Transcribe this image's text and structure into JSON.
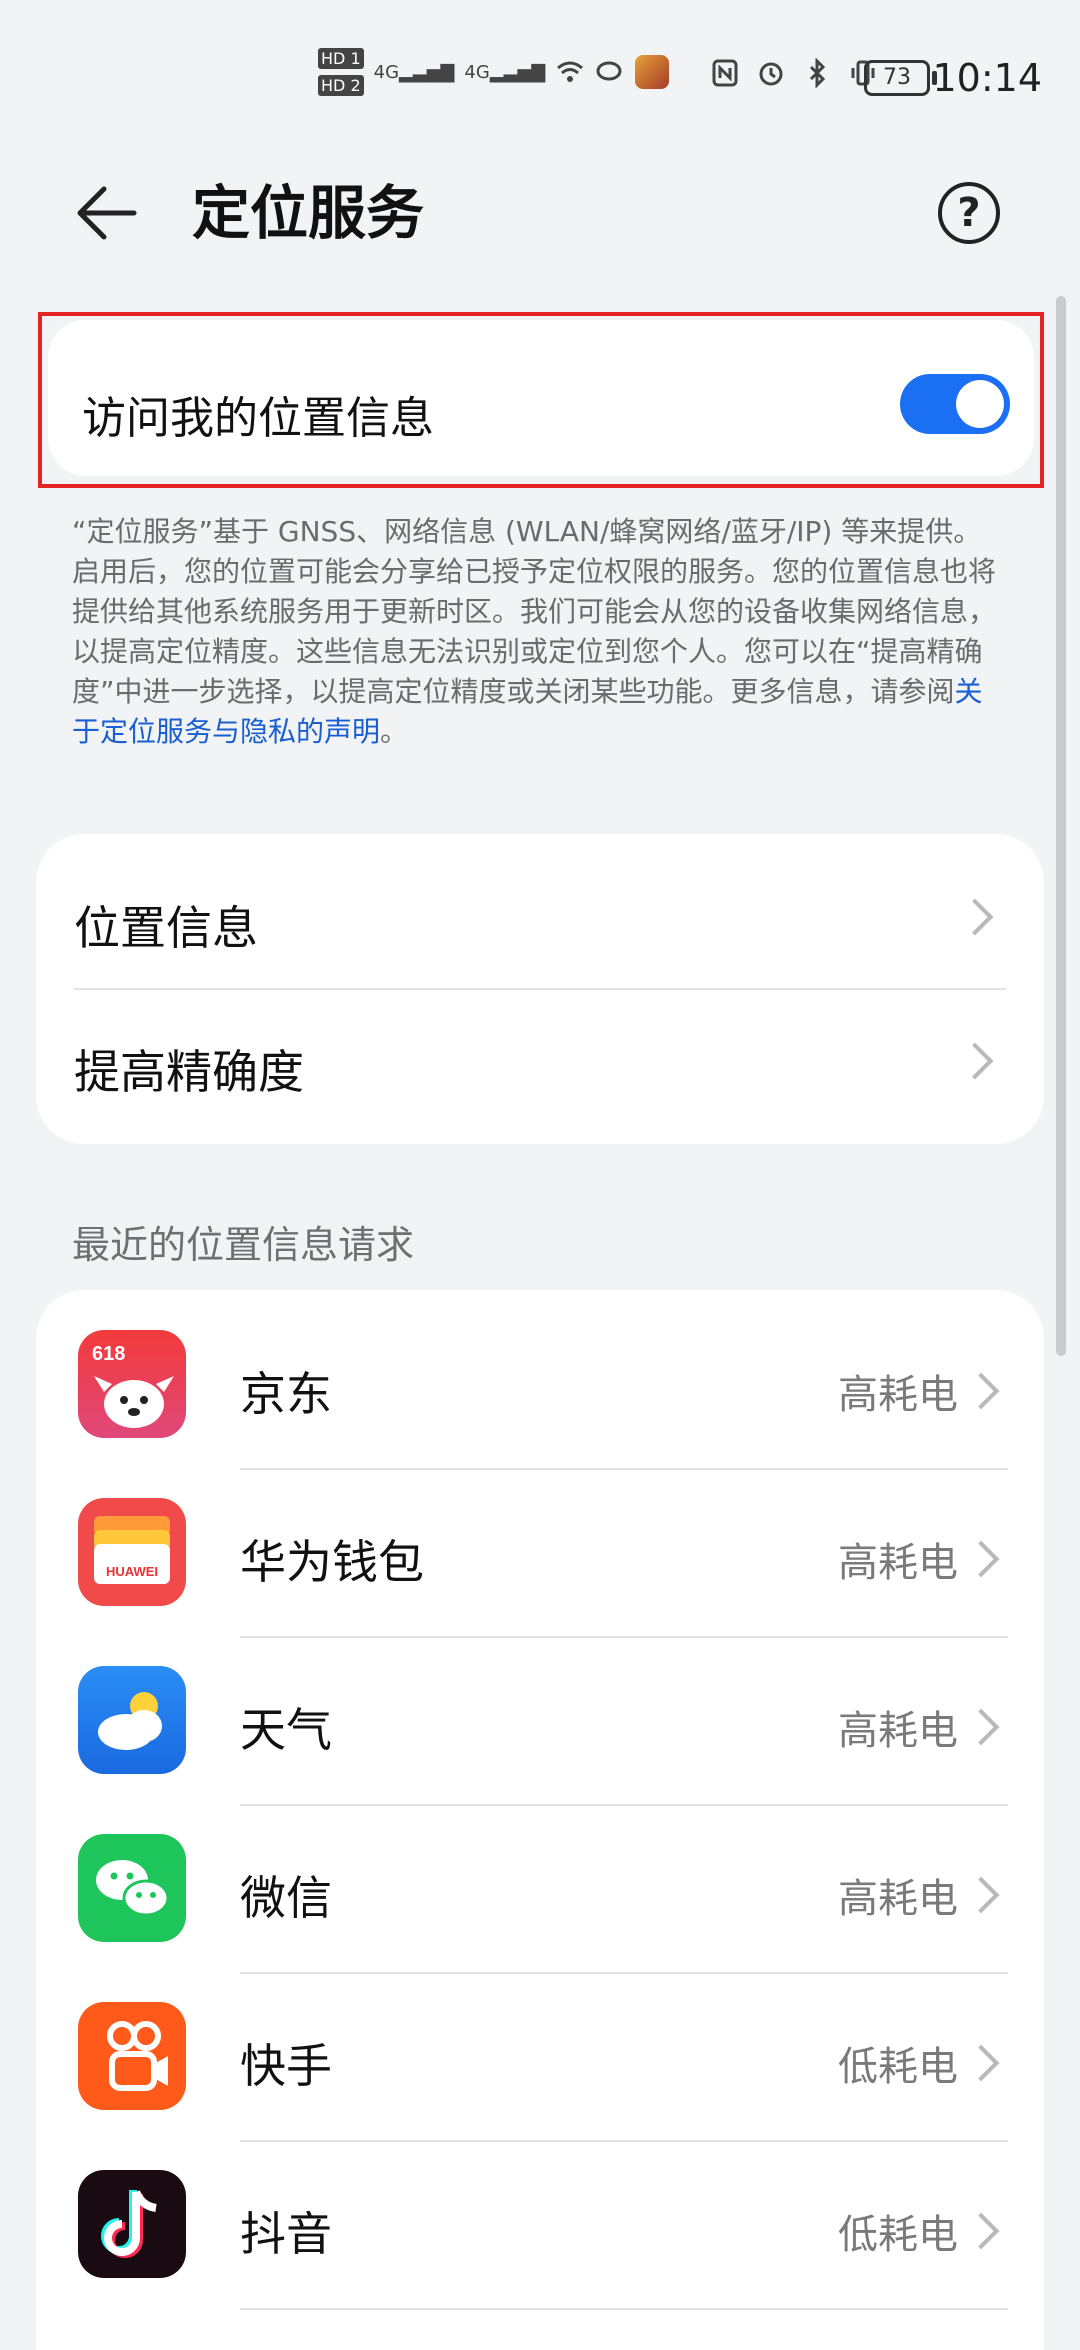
{
  "status_bar": {
    "hd1": "HD 1",
    "hd2": "HD 2",
    "signal1": "4G",
    "signal2": "4G",
    "battery": "73",
    "time": "10:14"
  },
  "header": {
    "title": "定位服务"
  },
  "access": {
    "label": "访问我的位置信息",
    "enabled": true
  },
  "description": {
    "text": "“定位服务”基于 GNSS、网络信息 (WLAN/蜂窝网络/蓝牙/IP) 等来提供。启用后，您的位置可能会分享给已授予定位权限的服务。您的位置信息也将提供给其他系统服务用于更新时区。我们可能会从您的设备收集网络信息，以提高定位精度。这些信息无法识别或定位到您个人。您可以在“提高精确度”中进一步选择，以提高定位精度或关闭某些功能。更多信息，请参阅",
    "link": "关于定位服务与隐私的声明",
    "end": "。"
  },
  "options": [
    {
      "label": "位置信息"
    },
    {
      "label": "提高精确度"
    }
  ],
  "recent": {
    "title": "最近的位置信息请求",
    "apps": [
      {
        "name": "京东",
        "power": "高耗电",
        "icon": "jd-icon",
        "icon_text": "618"
      },
      {
        "name": "华为钱包",
        "power": "高耗电",
        "icon": "huawei-wallet-icon",
        "icon_text": "HUAWEI"
      },
      {
        "name": "天气",
        "power": "高耗电",
        "icon": "weather-icon"
      },
      {
        "name": "微信",
        "power": "高耗电",
        "icon": "wechat-icon"
      },
      {
        "name": "快手",
        "power": "低耗电",
        "icon": "kuaishou-icon"
      },
      {
        "name": "抖音",
        "power": "低耗电",
        "icon": "douyin-icon"
      }
    ]
  },
  "colors": {
    "accent": "#1a6ff2",
    "highlight_border": "#e32525",
    "link": "#1a5fd1"
  }
}
